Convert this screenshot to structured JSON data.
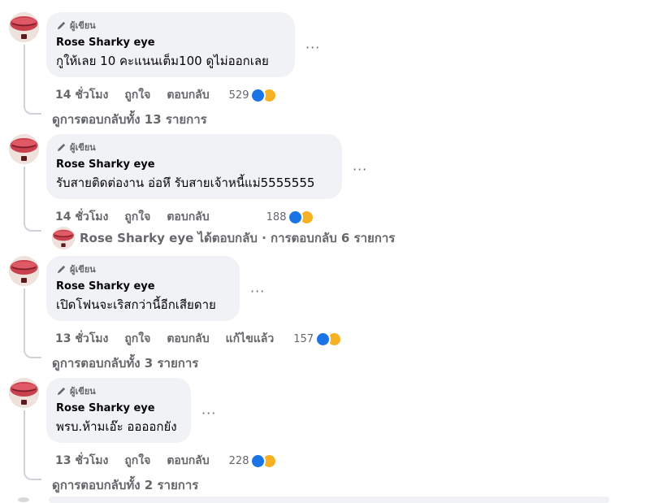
{
  "badge_label": "ผู้เขียน",
  "icons": {
    "pencil": "pencil-icon",
    "like": "like-icon",
    "haha": "haha-icon",
    "more": "more-options-icon"
  },
  "comments": [
    {
      "name": "Rose Sharky eye",
      "text": "กูให้เลย 10 คะแนนเต็ม100 ดูไม่ออกเลย",
      "time": "14 ชั่วโมง",
      "like": "ถูกใจ",
      "reply": "ตอบกลับ",
      "edited": "",
      "reactions": "529",
      "replies": "ดูการตอบกลับทั้ง 13 รายการ"
    },
    {
      "name": "Rose Sharky eye",
      "text": "รับสายติดต่องาน อ่อหึ รับสายเจ้าหนี้แม่5555555",
      "time": "14 ชั่วโมง",
      "like": "ถูกใจ",
      "reply": "ตอบกลับ",
      "edited": "",
      "reactions": "188",
      "reply_preview": "Rose Sharky eye ได้ตอบกลับ · การตอบกลับ 6 รายการ"
    },
    {
      "name": "Rose Sharky eye",
      "text": "เปิดโฟนจะเริสกว่านี้อีกเสียดาย",
      "time": "13 ชั่วโมง",
      "like": "ถูกใจ",
      "reply": "ตอบกลับ",
      "edited": "แก้ไขแล้ว",
      "reactions": "157",
      "replies": "ดูการตอบกลับทั้ง 3 รายการ"
    },
    {
      "name": "Rose Sharky eye",
      "text": "พรบ.ห้ามเอ๊ะ ออออกยัง",
      "time": "13 ชั่วโมง",
      "like": "ถูกใจ",
      "reply": "ตอบกลับ",
      "edited": "",
      "reactions": "228",
      "replies": "ดูการตอบกลับทั้ง 2 รายการ"
    }
  ],
  "colors": {
    "like": "#1b74e4",
    "haha": "#f7b125",
    "bubble": "#f0f2f5",
    "meta": "#65676b"
  }
}
